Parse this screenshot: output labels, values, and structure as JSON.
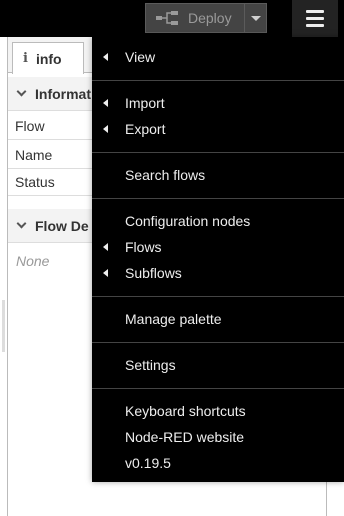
{
  "header": {
    "deploy_label": "Deploy"
  },
  "sidebar": {
    "tab_label": "info",
    "section_information": "Informat",
    "rows": [
      "Flow",
      "Name",
      "Status"
    ],
    "section_flow_description": "Flow De",
    "flow_description_value": "None"
  },
  "menu": {
    "items": [
      {
        "label": "View",
        "submenu": true
      },
      {
        "label": "Import",
        "submenu": true
      },
      {
        "label": "Export",
        "submenu": true
      },
      {
        "label": "Search flows",
        "submenu": false
      },
      {
        "label": "Configuration nodes",
        "submenu": false
      },
      {
        "label": "Flows",
        "submenu": true
      },
      {
        "label": "Subflows",
        "submenu": true
      },
      {
        "label": "Manage palette",
        "submenu": false
      },
      {
        "label": "Settings",
        "submenu": false
      },
      {
        "label": "Keyboard shortcuts",
        "submenu": false
      },
      {
        "label": "Node-RED website",
        "submenu": false
      },
      {
        "label": "v0.19.5",
        "submenu": false
      }
    ]
  },
  "colors": {
    "header_bg": "#000000",
    "menu_bg": "#000000",
    "menu_text": "#eeeeee",
    "deploy_bg": "#444444",
    "deploy_text": "#9a9a9a"
  }
}
